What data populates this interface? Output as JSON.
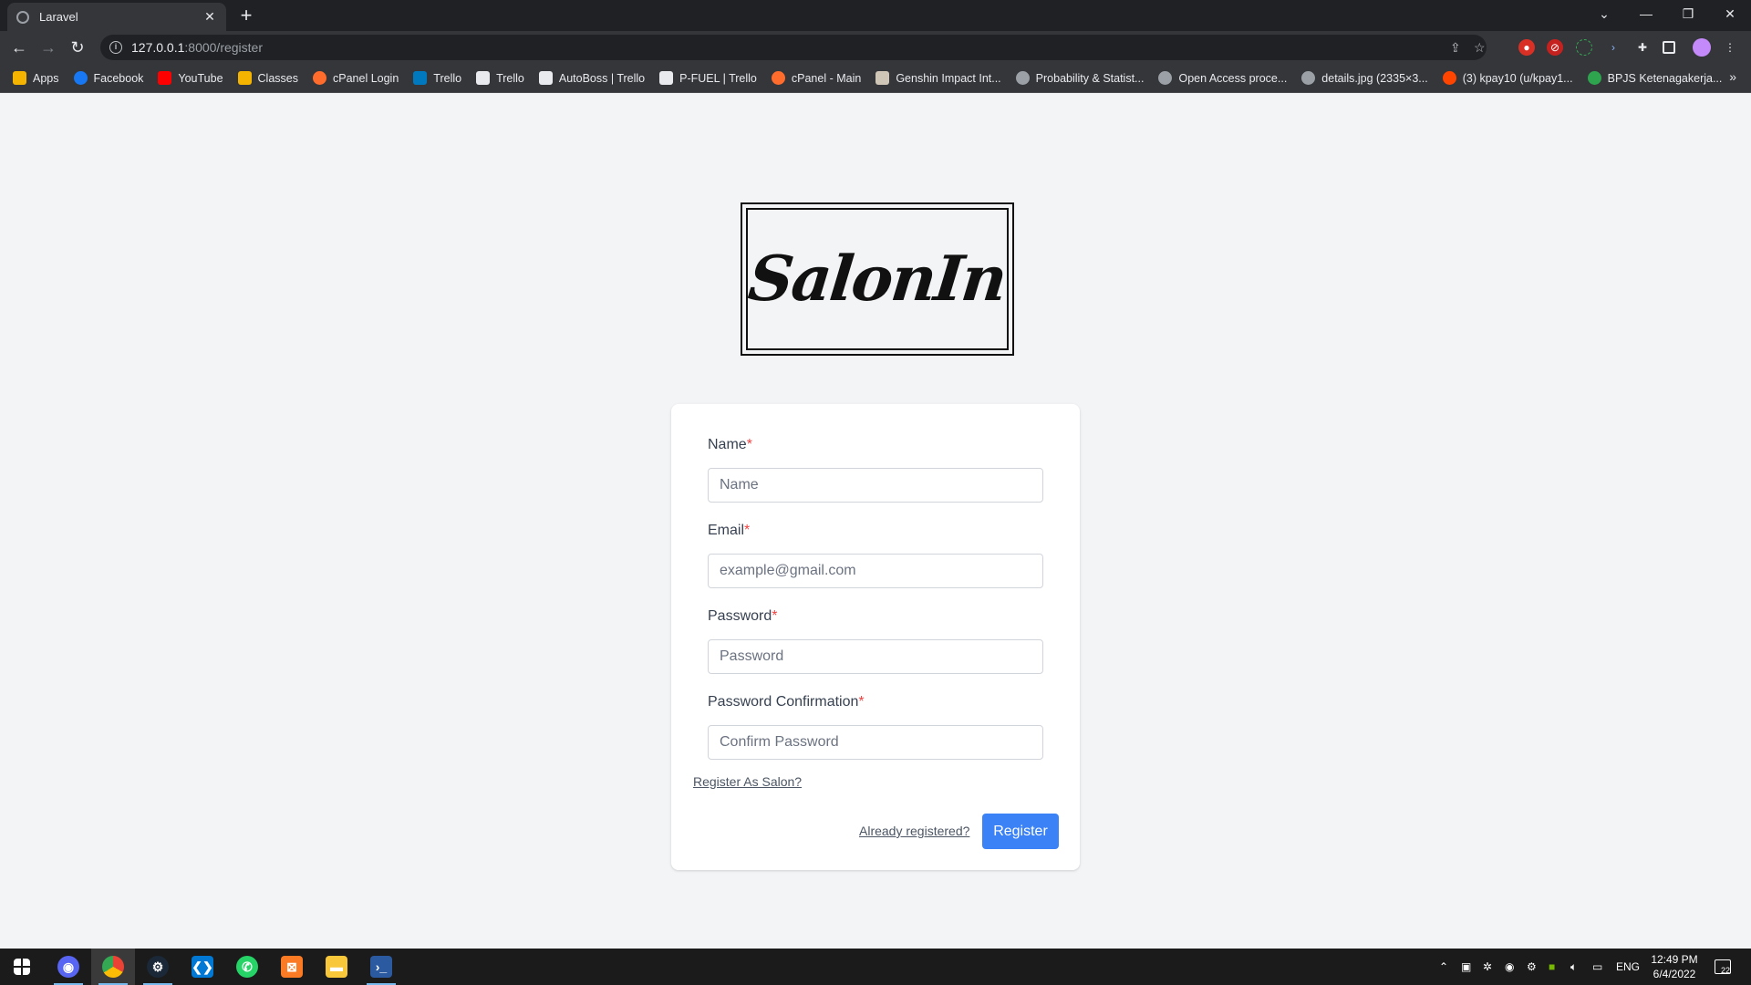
{
  "browser": {
    "tab_title": "Laravel",
    "url_host": "127.0.0.1",
    "url_path": ":8000/register",
    "bookmarks": [
      {
        "label": "Apps",
        "color": "#f4b400"
      },
      {
        "label": "Facebook",
        "color": "#1877f2"
      },
      {
        "label": "YouTube",
        "color": "#ff0000"
      },
      {
        "label": "Classes",
        "color": "#f4b400"
      },
      {
        "label": "cPanel Login",
        "color": "#ff6c2c"
      },
      {
        "label": "Trello",
        "color": "#0079bf"
      },
      {
        "label": "Trello",
        "color": "#e8eaed"
      },
      {
        "label": "AutoBoss | Trello",
        "color": "#e8eaed"
      },
      {
        "label": "P-FUEL | Trello",
        "color": "#e8eaed"
      },
      {
        "label": "cPanel - Main",
        "color": "#ff6c2c"
      },
      {
        "label": "Genshin Impact Int...",
        "color": "#cfc6b8"
      },
      {
        "label": "Probability & Statist...",
        "color": "#9aa0a6"
      },
      {
        "label": "Open Access proce...",
        "color": "#9aa0a6"
      },
      {
        "label": "details.jpg (2335×3...",
        "color": "#9aa0a6"
      },
      {
        "label": "(3) kpay10 (u/kpay1...",
        "color": "#ff4500"
      },
      {
        "label": "BPJS Ketenagakerja...",
        "color": "#2ea44f"
      }
    ]
  },
  "page": {
    "logo_text": "SalonIn",
    "form": {
      "name_label": "Name",
      "name_placeholder": "Name",
      "email_label": "Email",
      "email_placeholder": "example@gmail.com",
      "password_label": "Password",
      "password_placeholder": "Password",
      "password_confirm_label": "Password Confirmation",
      "password_confirm_placeholder": "Confirm Password",
      "required_mark": "*",
      "register_salon_link": "Register As Salon?",
      "already_registered_link": "Already registered?",
      "register_button": "Register"
    },
    "colors": {
      "accent": "#3b82f6",
      "required": "#ef4444"
    }
  },
  "taskbar": {
    "apps": [
      "discord-icon",
      "chrome-icon",
      "steam-icon",
      "vscode-icon",
      "whatsapp-icon",
      "xampp-icon",
      "file-explorer-icon",
      "powershell-icon"
    ],
    "language": "ENG",
    "time": "12:49 PM",
    "date": "6/4/2022",
    "notifications": "22"
  }
}
